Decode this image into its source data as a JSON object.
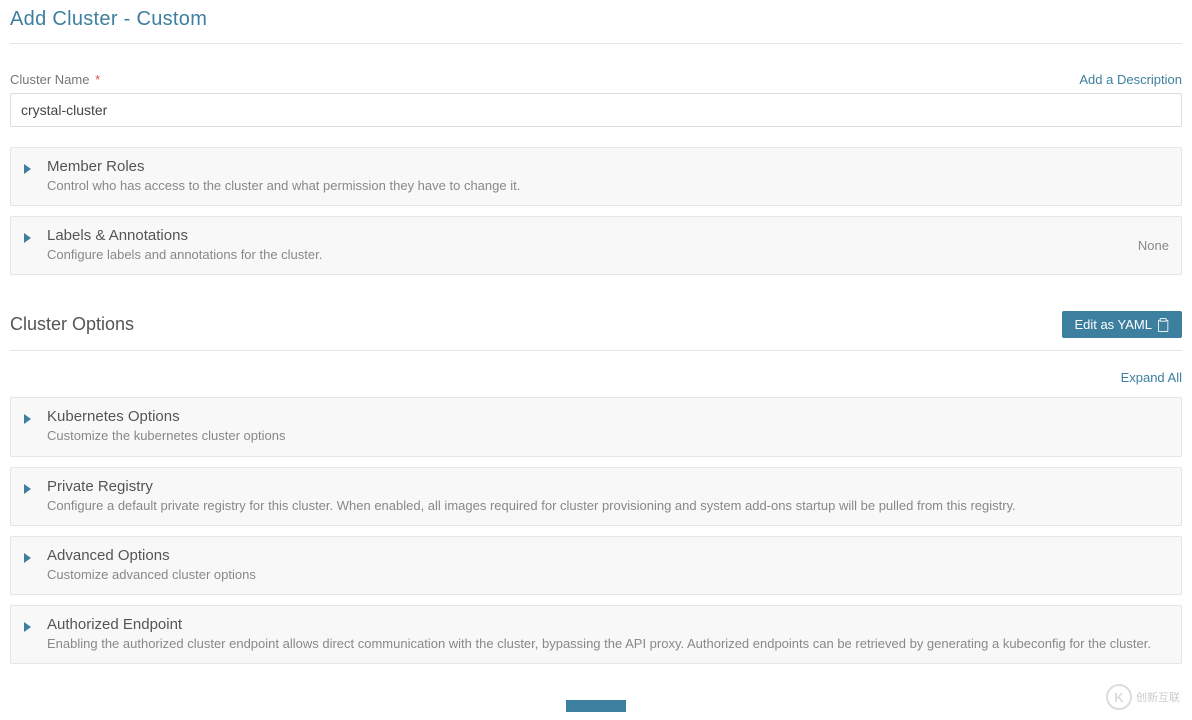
{
  "page": {
    "title": "Add Cluster - Custom"
  },
  "cluster_name": {
    "label": "Cluster Name",
    "required_marker": "*",
    "value": "crystal-cluster",
    "add_description_link": "Add a Description"
  },
  "panels_top": [
    {
      "title": "Member Roles",
      "description": "Control who has access to the cluster and what permission they have to change it.",
      "right": ""
    },
    {
      "title": "Labels & Annotations",
      "description": "Configure labels and annotations for the cluster.",
      "right": "None"
    }
  ],
  "cluster_options": {
    "title": "Cluster Options",
    "yaml_button": "Edit as YAML",
    "expand_all": "Expand All"
  },
  "panels_options": [
    {
      "title": "Kubernetes Options",
      "description": "Customize the kubernetes cluster options"
    },
    {
      "title": "Private Registry",
      "description": "Configure a default private registry for this cluster. When enabled, all images required for cluster provisioning and system add-ons startup will be pulled from this registry."
    },
    {
      "title": "Advanced Options",
      "description": "Customize advanced cluster options"
    },
    {
      "title": "Authorized Endpoint",
      "description": "Enabling the authorized cluster endpoint allows direct communication with the cluster, bypassing the API proxy. Authorized endpoints can be retrieved by generating a kubeconfig for the cluster."
    }
  ],
  "watermark": {
    "logo_letter": "K",
    "text": "创新互联"
  }
}
